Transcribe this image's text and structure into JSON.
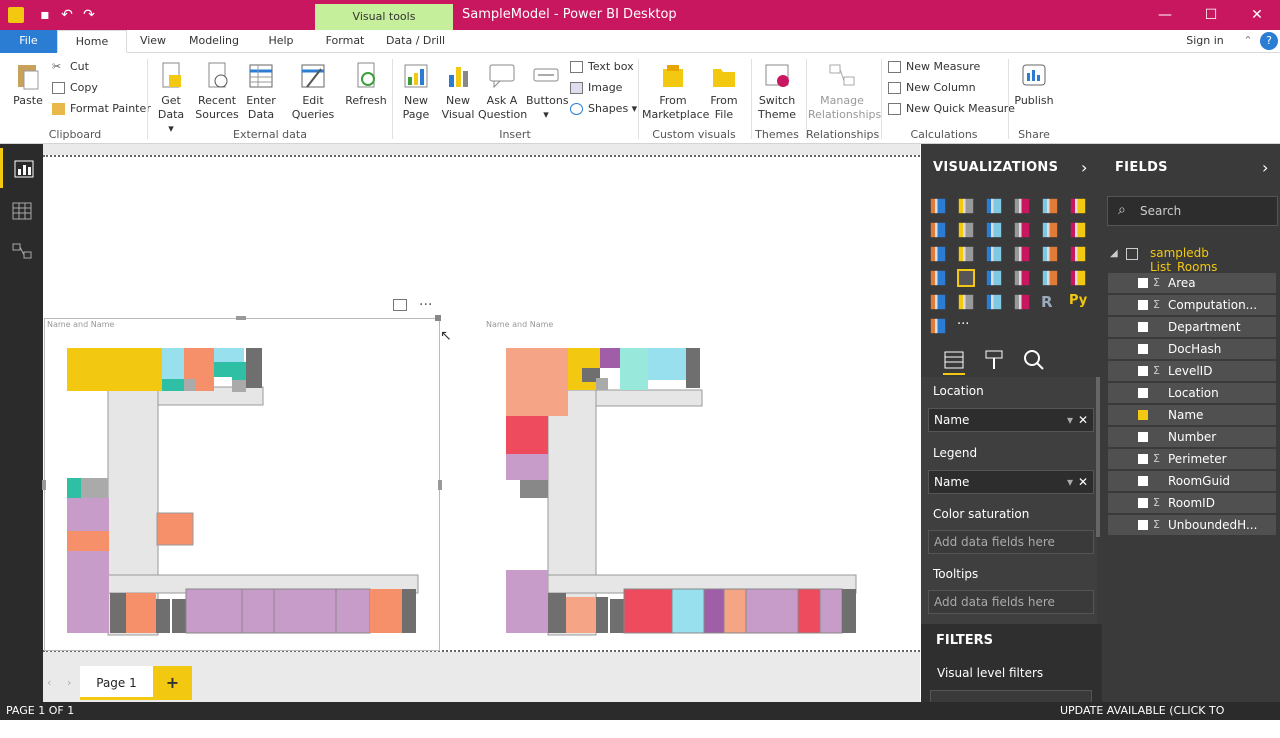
{
  "window": {
    "title": "SampleModel - Power BI Desktop",
    "context_tab": "Visual tools"
  },
  "tabs": [
    "File",
    "Home",
    "View",
    "Modeling",
    "Help",
    "Format",
    "Data / Drill"
  ],
  "account": {
    "sign_in": "Sign in"
  },
  "ribbon": {
    "clipboard": {
      "paste": "Paste",
      "cut": "Cut",
      "copy": "Copy",
      "format_painter": "Format Painter",
      "group": "Clipboard"
    },
    "external": {
      "get_data": "Get Data",
      "recent_sources": "Recent Sources",
      "enter_data": "Enter Data",
      "edit_queries": "Edit Queries",
      "refresh": "Refresh",
      "group": "External data"
    },
    "insert": {
      "new_page": "New Page",
      "new_visual": "New Visual",
      "ask": "Ask A Question",
      "buttons": "Buttons",
      "text_box": "Text box",
      "image": "Image",
      "shapes": "Shapes",
      "group": "Insert"
    },
    "custom": {
      "marketplace": "From Marketplace",
      "file": "From File",
      "group": "Custom visuals"
    },
    "themes": {
      "switch": "Switch Theme",
      "group": "Themes"
    },
    "relationships": {
      "manage": "Manage Relationships",
      "group": "Relationships"
    },
    "calculations": {
      "new_measure": "New Measure",
      "new_column": "New Column",
      "new_quick_measure": "New Quick Measure",
      "group": "Calculations"
    },
    "share": {
      "publish": "Publish",
      "group": "Share"
    }
  },
  "maps": {
    "left_title": "Name and Name",
    "right_title": "Name and Name"
  },
  "pages": {
    "current": "Page 1",
    "add": "+"
  },
  "status": {
    "page": "PAGE 1 OF 1",
    "update": "UPDATE AVAILABLE (CLICK TO DOWNLOAD)"
  },
  "visualizations": {
    "header": "VISUALIZATIONS",
    "r_label": "R",
    "py_label": "Py",
    "more": "···",
    "wells": {
      "location_label": "Location",
      "location_value": "Name",
      "legend_label": "Legend",
      "legend_value": "Name",
      "saturation_label": "Color saturation",
      "saturation_placeholder": "Add data fields here",
      "tooltips_label": "Tooltips",
      "tooltips_placeholder": "Add data fields here"
    }
  },
  "filters": {
    "header": "FILTERS",
    "visual_level": "Visual level filters"
  },
  "fields": {
    "header": "FIELDS",
    "search_placeholder": "Search",
    "table": "sampledb List_Rooms",
    "items": [
      {
        "name": "Area",
        "sigma": true,
        "checked": false
      },
      {
        "name": "Computation...",
        "sigma": true,
        "checked": false
      },
      {
        "name": "Department",
        "sigma": false,
        "checked": false
      },
      {
        "name": "DocHash",
        "sigma": false,
        "checked": false
      },
      {
        "name": "LevelID",
        "sigma": true,
        "checked": false
      },
      {
        "name": "Location",
        "sigma": false,
        "checked": false
      },
      {
        "name": "Name",
        "sigma": false,
        "checked": true
      },
      {
        "name": "Number",
        "sigma": false,
        "checked": false
      },
      {
        "name": "Perimeter",
        "sigma": true,
        "checked": false
      },
      {
        "name": "RoomGuid",
        "sigma": false,
        "checked": false
      },
      {
        "name": "RoomID",
        "sigma": true,
        "checked": false
      },
      {
        "name": "UnboundedH...",
        "sigma": true,
        "checked": false
      }
    ]
  },
  "colors": {
    "brand": "#c8175f",
    "accent": "#f2c811",
    "file_tab": "#2b7cd3"
  }
}
